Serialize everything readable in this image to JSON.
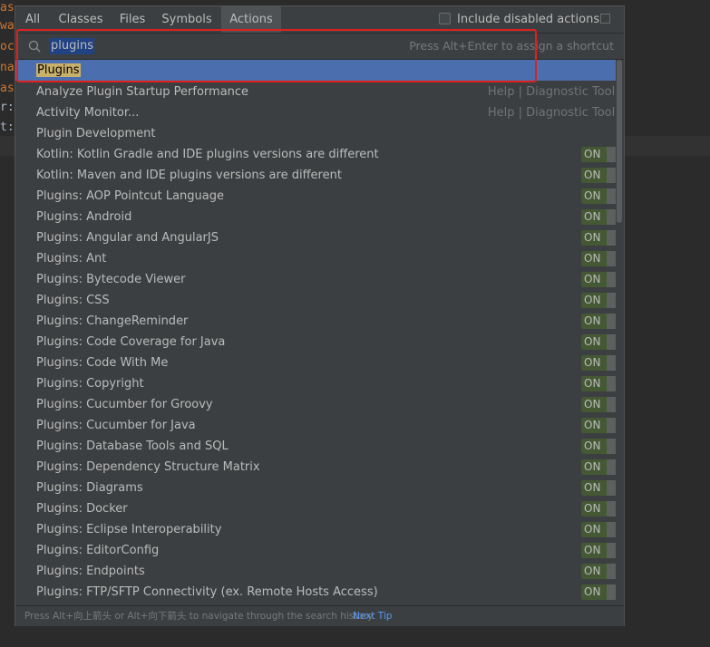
{
  "editor": {
    "lines": [
      "as",
      "wa",
      "oc",
      "na",
      "as",
      "r:",
      "t:"
    ]
  },
  "tabs": [
    {
      "label": "All"
    },
    {
      "label": "Classes"
    },
    {
      "label": "Files"
    },
    {
      "label": "Symbols"
    },
    {
      "label": "Actions"
    }
  ],
  "include_disabled_label": "Include disabled actions",
  "search": {
    "value": "plugins",
    "hint": "Press Alt+Enter to assign a shortcut"
  },
  "results": [
    {
      "label": "Plugins",
      "category": "",
      "toggle": ""
    },
    {
      "label": "Analyze Plugin Startup Performance",
      "category": "Help | Diagnostic Tools",
      "toggle": ""
    },
    {
      "label": "Activity Monitor...",
      "category": "Help | Diagnostic Tools",
      "toggle": ""
    },
    {
      "label": "Plugin Development",
      "category": "",
      "toggle": ""
    },
    {
      "label": "Kotlin: Kotlin Gradle and IDE plugins versions are different",
      "category": "",
      "toggle": "ON"
    },
    {
      "label": "Kotlin: Maven and IDE plugins versions are different",
      "category": "",
      "toggle": "ON"
    },
    {
      "label": "Plugins: AOP Pointcut Language",
      "category": "",
      "toggle": "ON"
    },
    {
      "label": "Plugins: Android",
      "category": "",
      "toggle": "ON"
    },
    {
      "label": "Plugins: Angular and AngularJS",
      "category": "",
      "toggle": "ON"
    },
    {
      "label": "Plugins: Ant",
      "category": "",
      "toggle": "ON"
    },
    {
      "label": "Plugins: Bytecode Viewer",
      "category": "",
      "toggle": "ON"
    },
    {
      "label": "Plugins: CSS",
      "category": "",
      "toggle": "ON"
    },
    {
      "label": "Plugins: ChangeReminder",
      "category": "",
      "toggle": "ON"
    },
    {
      "label": "Plugins: Code Coverage for Java",
      "category": "",
      "toggle": "ON"
    },
    {
      "label": "Plugins: Code With Me",
      "category": "",
      "toggle": "ON"
    },
    {
      "label": "Plugins: Copyright",
      "category": "",
      "toggle": "ON"
    },
    {
      "label": "Plugins: Cucumber for Groovy",
      "category": "",
      "toggle": "ON"
    },
    {
      "label": "Plugins: Cucumber for Java",
      "category": "",
      "toggle": "ON"
    },
    {
      "label": "Plugins: Database Tools and SQL",
      "category": "",
      "toggle": "ON"
    },
    {
      "label": "Plugins: Dependency Structure Matrix",
      "category": "",
      "toggle": "ON"
    },
    {
      "label": "Plugins: Diagrams",
      "category": "",
      "toggle": "ON"
    },
    {
      "label": "Plugins: Docker",
      "category": "",
      "toggle": "ON"
    },
    {
      "label": "Plugins: Eclipse Interoperability",
      "category": "",
      "toggle": "ON"
    },
    {
      "label": "Plugins: EditorConfig",
      "category": "",
      "toggle": "ON"
    },
    {
      "label": "Plugins: Endpoints",
      "category": "",
      "toggle": "ON"
    },
    {
      "label": "Plugins: FTP/SFTP Connectivity (ex. Remote Hosts Access)",
      "category": "",
      "toggle": "ON"
    }
  ],
  "footer": {
    "tip": "Press Alt+向上箭头 or Alt+向下箭头 to navigate through the search history",
    "next_tip": "Next Tip"
  }
}
